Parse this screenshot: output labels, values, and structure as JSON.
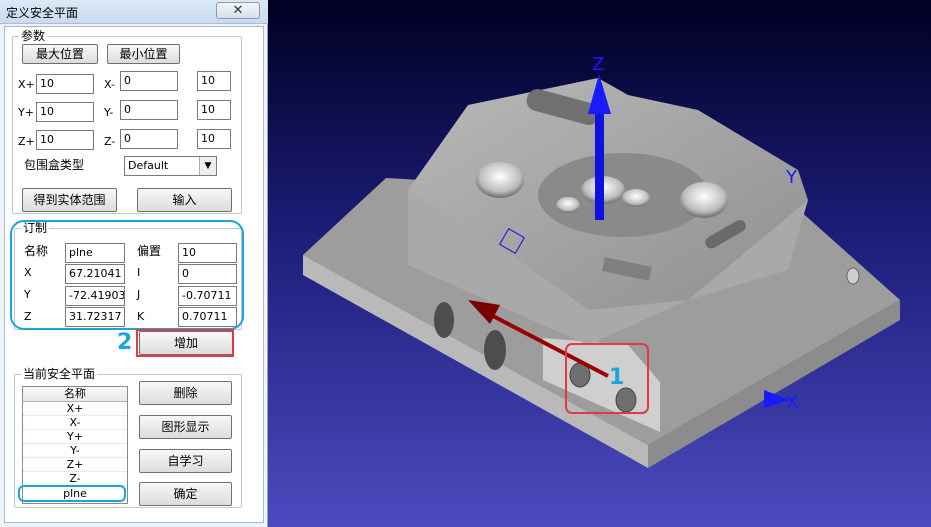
{
  "window": {
    "title": "定义安全平面",
    "close_glyph": "✕"
  },
  "params": {
    "group_label": "参数",
    "max_pos_button": "最大位置",
    "min_pos_button": "最小位置",
    "rows": [
      {
        "plus_label": "X+",
        "plus_value": "10",
        "minus_label": "X-",
        "minus_value": "0",
        "extra_value": "10"
      },
      {
        "plus_label": "Y+",
        "plus_value": "10",
        "minus_label": "Y-",
        "minus_value": "0",
        "extra_value": "10"
      },
      {
        "plus_label": "Z+",
        "plus_value": "10",
        "minus_label": "Z-",
        "minus_value": "0",
        "extra_value": "10"
      }
    ],
    "bbox_type_label": "包围盒类型",
    "bbox_type_value": "Default",
    "get_solid_range_button": "得到实体范围",
    "input_button": "输入"
  },
  "custom": {
    "group_label": "订制",
    "name_label": "名称",
    "name_value": "plne",
    "offset_label": "偏置",
    "offset_value": "10",
    "x_label": "X",
    "x_value": "67.21041",
    "i_label": "I",
    "i_value": "0",
    "y_label": "Y",
    "y_value": "-72.41903",
    "j_label": "J",
    "j_value": "-0.70711",
    "z_label": "Z",
    "z_value": "31.72317",
    "k_label": "K",
    "k_value": "0.70711",
    "add_button": "增加"
  },
  "current": {
    "group_label": "当前安全平面",
    "column_header": "名称",
    "items": [
      "X+",
      "X-",
      "Y+",
      "Y-",
      "Z+",
      "Z-",
      "plne"
    ],
    "delete_button": "删除",
    "graphic_display_button": "图形显示",
    "self_learn_button": "自学习",
    "ok_button": "确定"
  },
  "viewport": {
    "axis_z": "Z",
    "axis_y": "Y",
    "axis_x": "X",
    "colors": {
      "background_top": "#000022",
      "background_bottom": "#4b4bbf",
      "axis": "#1010e0",
      "normal": "#990000",
      "part": "#c8c8c8"
    }
  },
  "annotations": {
    "step1": "1",
    "step2": "2",
    "highlight_color": "#e23a45",
    "callout_color": "#1da3de"
  }
}
